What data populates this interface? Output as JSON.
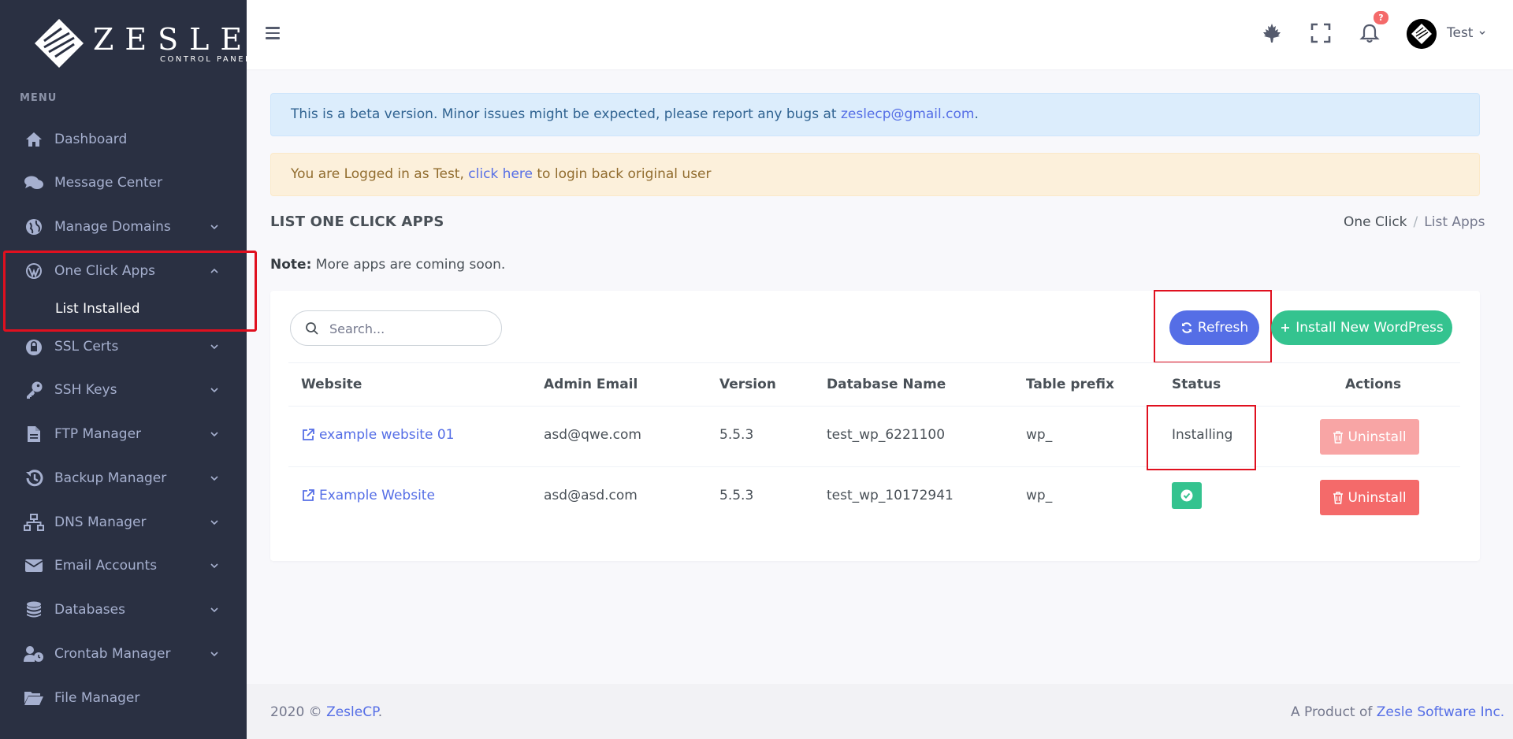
{
  "brand": {
    "name": "ZESLE",
    "tagline": "CONTROL PANEL"
  },
  "sidebar": {
    "menu_title": "MENU",
    "items": [
      {
        "label": "Dashboard",
        "icon": "home-icon",
        "has_chevron": false
      },
      {
        "label": "Message Center",
        "icon": "chat-icon",
        "has_chevron": false
      },
      {
        "label": "Manage Domains",
        "icon": "globe-icon",
        "has_chevron": true
      },
      {
        "label": "One Click Apps",
        "icon": "wordpress-icon",
        "has_chevron": true,
        "expanded": true
      },
      {
        "label": "SSL Certs",
        "icon": "lock-icon",
        "has_chevron": true
      },
      {
        "label": "SSH Keys",
        "icon": "key-icon",
        "has_chevron": true
      },
      {
        "label": "FTP Manager",
        "icon": "file-icon",
        "has_chevron": true
      },
      {
        "label": "Backup Manager",
        "icon": "history-icon",
        "has_chevron": true
      },
      {
        "label": "DNS Manager",
        "icon": "sitemap-icon",
        "has_chevron": true
      },
      {
        "label": "Email Accounts",
        "icon": "envelope-icon",
        "has_chevron": true
      },
      {
        "label": "Databases",
        "icon": "database-icon",
        "has_chevron": true
      },
      {
        "label": "Crontab Manager",
        "icon": "user-clock-icon",
        "has_chevron": true
      },
      {
        "label": "File Manager",
        "icon": "folder-open-icon",
        "has_chevron": false
      }
    ],
    "submenu": {
      "label": "List Installed"
    }
  },
  "topbar": {
    "notification_count": "?",
    "user_name": "Test"
  },
  "alerts": {
    "beta": {
      "text": "This is a beta version. Minor issues might be expected, please report any bugs at ",
      "link": "zeslecp@gmail.com",
      "suffix": "."
    },
    "login": {
      "prefix": "You are Logged in as Test, ",
      "link": "click here",
      "suffix": " to login back original user"
    }
  },
  "page": {
    "title": "LIST ONE CLICK APPS",
    "breadcrumb": [
      "One Click",
      "List Apps"
    ],
    "note_label": "Note:",
    "note_text": " More apps are coming soon."
  },
  "toolbar": {
    "search_placeholder": "Search...",
    "refresh_label": "Refresh",
    "install_label": "Install New WordPress"
  },
  "table": {
    "headers": [
      "Website",
      "Admin Email",
      "Version",
      "Database Name",
      "Table prefix",
      "Status",
      "Actions"
    ],
    "rows": [
      {
        "website": "example website 01",
        "email": "asd@qwe.com",
        "version": "5.5.3",
        "db": "test_wp_6221100",
        "prefix": "wp_",
        "status": "Installing",
        "action": "Uninstall"
      },
      {
        "website": "Example Website",
        "email": "asd@asd.com",
        "version": "5.5.3",
        "db": "test_wp_10172941",
        "prefix": "wp_",
        "status": "ok",
        "action": "Uninstall"
      }
    ]
  },
  "footer": {
    "left_prefix": "2020 © ",
    "left_link": "ZesleCP",
    "left_suffix": ".",
    "right_prefix": "A Product of ",
    "right_link": "Zesle Software Inc."
  },
  "colors": {
    "sidebar_bg": "#2a3042",
    "primary": "#556ee6",
    "success": "#34c38f",
    "danger": "#f46a6a",
    "highlight": "#e0101f"
  }
}
